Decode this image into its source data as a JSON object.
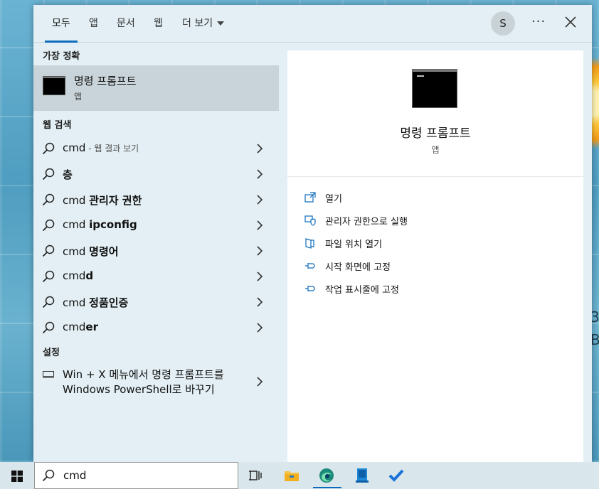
{
  "tabs": [
    "모두",
    "앱",
    "문서",
    "웹",
    "더 보기"
  ],
  "account_initial": "S",
  "more_label": "···",
  "best_match": {
    "heading": "가장 정확",
    "title": "명령 프롬프트",
    "subtitle": "앱"
  },
  "web_search": {
    "heading": "웹 검색",
    "items": [
      {
        "prefix": "cmd",
        "bold": "",
        "hint": " - 웹 결과 보기"
      },
      {
        "prefix": "",
        "bold": "층",
        "hint": ""
      },
      {
        "prefix": "cmd ",
        "bold": "관리자 권한",
        "hint": ""
      },
      {
        "prefix": "cmd ",
        "bold": "ipconfig",
        "hint": ""
      },
      {
        "prefix": "cmd ",
        "bold": "명령어",
        "hint": ""
      },
      {
        "prefix": "cmd",
        "bold": "d",
        "hint": ""
      },
      {
        "prefix": "cmd ",
        "bold": "정품인증",
        "hint": ""
      },
      {
        "prefix": "cmd",
        "bold": "er",
        "hint": ""
      }
    ]
  },
  "settings": {
    "heading": "설정",
    "line1": "Win + X 메뉴에서 명령 프롬프트를",
    "line2": "Windows PowerShell로 바꾸기"
  },
  "detail": {
    "title": "명령 프롬프트",
    "subtitle": "앱",
    "actions": [
      "열기",
      "관리자 권한으로 실행",
      "파일 위치 열기",
      "시작 화면에 고정",
      "작업 표시줄에 고정"
    ]
  },
  "taskbar": {
    "search_value": "cmd"
  },
  "colors": {
    "accent": "#0f6cbd",
    "panel_bg": "#e3eff4",
    "selected_bg": "#c8d4d9"
  }
}
